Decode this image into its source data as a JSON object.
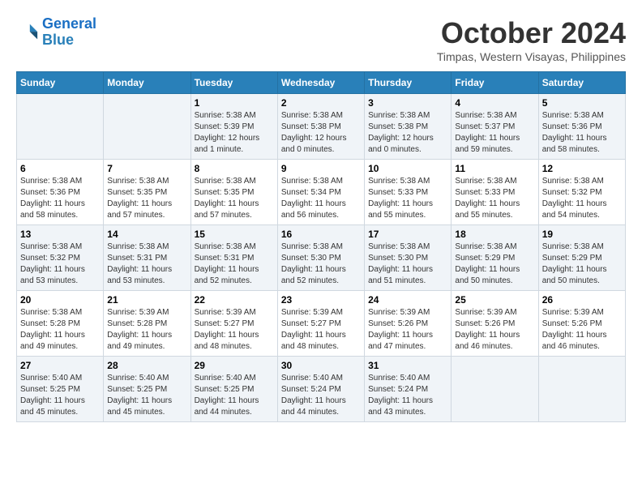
{
  "header": {
    "logo_line1": "General",
    "logo_line2": "Blue",
    "month": "October 2024",
    "location": "Timpas, Western Visayas, Philippines"
  },
  "weekdays": [
    "Sunday",
    "Monday",
    "Tuesday",
    "Wednesday",
    "Thursday",
    "Friday",
    "Saturday"
  ],
  "weeks": [
    [
      {
        "day": "",
        "info": ""
      },
      {
        "day": "",
        "info": ""
      },
      {
        "day": "1",
        "info": "Sunrise: 5:38 AM\nSunset: 5:39 PM\nDaylight: 12 hours\nand 1 minute."
      },
      {
        "day": "2",
        "info": "Sunrise: 5:38 AM\nSunset: 5:38 PM\nDaylight: 12 hours\nand 0 minutes."
      },
      {
        "day": "3",
        "info": "Sunrise: 5:38 AM\nSunset: 5:38 PM\nDaylight: 12 hours\nand 0 minutes."
      },
      {
        "day": "4",
        "info": "Sunrise: 5:38 AM\nSunset: 5:37 PM\nDaylight: 11 hours\nand 59 minutes."
      },
      {
        "day": "5",
        "info": "Sunrise: 5:38 AM\nSunset: 5:36 PM\nDaylight: 11 hours\nand 58 minutes."
      }
    ],
    [
      {
        "day": "6",
        "info": "Sunrise: 5:38 AM\nSunset: 5:36 PM\nDaylight: 11 hours\nand 58 minutes."
      },
      {
        "day": "7",
        "info": "Sunrise: 5:38 AM\nSunset: 5:35 PM\nDaylight: 11 hours\nand 57 minutes."
      },
      {
        "day": "8",
        "info": "Sunrise: 5:38 AM\nSunset: 5:35 PM\nDaylight: 11 hours\nand 57 minutes."
      },
      {
        "day": "9",
        "info": "Sunrise: 5:38 AM\nSunset: 5:34 PM\nDaylight: 11 hours\nand 56 minutes."
      },
      {
        "day": "10",
        "info": "Sunrise: 5:38 AM\nSunset: 5:33 PM\nDaylight: 11 hours\nand 55 minutes."
      },
      {
        "day": "11",
        "info": "Sunrise: 5:38 AM\nSunset: 5:33 PM\nDaylight: 11 hours\nand 55 minutes."
      },
      {
        "day": "12",
        "info": "Sunrise: 5:38 AM\nSunset: 5:32 PM\nDaylight: 11 hours\nand 54 minutes."
      }
    ],
    [
      {
        "day": "13",
        "info": "Sunrise: 5:38 AM\nSunset: 5:32 PM\nDaylight: 11 hours\nand 53 minutes."
      },
      {
        "day": "14",
        "info": "Sunrise: 5:38 AM\nSunset: 5:31 PM\nDaylight: 11 hours\nand 53 minutes."
      },
      {
        "day": "15",
        "info": "Sunrise: 5:38 AM\nSunset: 5:31 PM\nDaylight: 11 hours\nand 52 minutes."
      },
      {
        "day": "16",
        "info": "Sunrise: 5:38 AM\nSunset: 5:30 PM\nDaylight: 11 hours\nand 52 minutes."
      },
      {
        "day": "17",
        "info": "Sunrise: 5:38 AM\nSunset: 5:30 PM\nDaylight: 11 hours\nand 51 minutes."
      },
      {
        "day": "18",
        "info": "Sunrise: 5:38 AM\nSunset: 5:29 PM\nDaylight: 11 hours\nand 50 minutes."
      },
      {
        "day": "19",
        "info": "Sunrise: 5:38 AM\nSunset: 5:29 PM\nDaylight: 11 hours\nand 50 minutes."
      }
    ],
    [
      {
        "day": "20",
        "info": "Sunrise: 5:38 AM\nSunset: 5:28 PM\nDaylight: 11 hours\nand 49 minutes."
      },
      {
        "day": "21",
        "info": "Sunrise: 5:39 AM\nSunset: 5:28 PM\nDaylight: 11 hours\nand 49 minutes."
      },
      {
        "day": "22",
        "info": "Sunrise: 5:39 AM\nSunset: 5:27 PM\nDaylight: 11 hours\nand 48 minutes."
      },
      {
        "day": "23",
        "info": "Sunrise: 5:39 AM\nSunset: 5:27 PM\nDaylight: 11 hours\nand 48 minutes."
      },
      {
        "day": "24",
        "info": "Sunrise: 5:39 AM\nSunset: 5:26 PM\nDaylight: 11 hours\nand 47 minutes."
      },
      {
        "day": "25",
        "info": "Sunrise: 5:39 AM\nSunset: 5:26 PM\nDaylight: 11 hours\nand 46 minutes."
      },
      {
        "day": "26",
        "info": "Sunrise: 5:39 AM\nSunset: 5:26 PM\nDaylight: 11 hours\nand 46 minutes."
      }
    ],
    [
      {
        "day": "27",
        "info": "Sunrise: 5:40 AM\nSunset: 5:25 PM\nDaylight: 11 hours\nand 45 minutes."
      },
      {
        "day": "28",
        "info": "Sunrise: 5:40 AM\nSunset: 5:25 PM\nDaylight: 11 hours\nand 45 minutes."
      },
      {
        "day": "29",
        "info": "Sunrise: 5:40 AM\nSunset: 5:25 PM\nDaylight: 11 hours\nand 44 minutes."
      },
      {
        "day": "30",
        "info": "Sunrise: 5:40 AM\nSunset: 5:24 PM\nDaylight: 11 hours\nand 44 minutes."
      },
      {
        "day": "31",
        "info": "Sunrise: 5:40 AM\nSunset: 5:24 PM\nDaylight: 11 hours\nand 43 minutes."
      },
      {
        "day": "",
        "info": ""
      },
      {
        "day": "",
        "info": ""
      }
    ]
  ]
}
